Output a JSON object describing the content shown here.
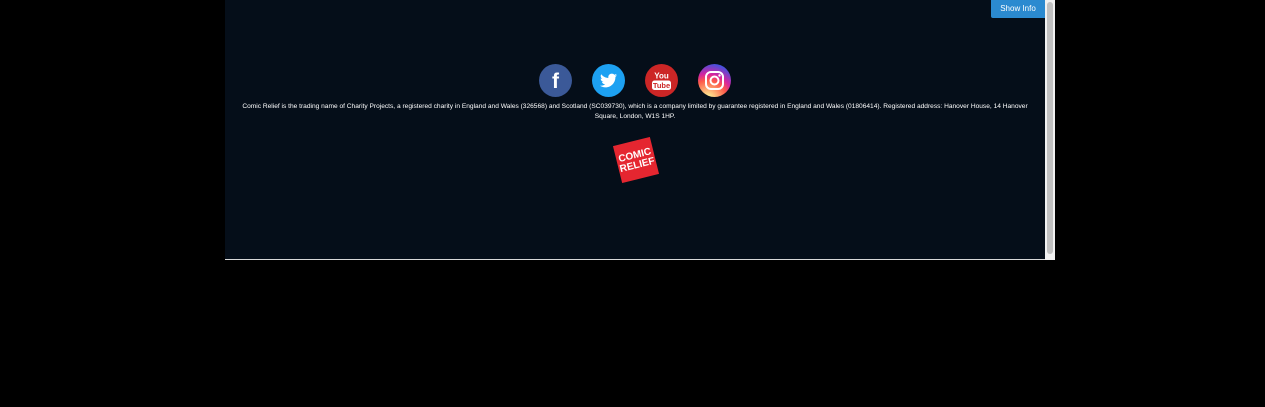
{
  "show_info_button": {
    "label": "Show Info"
  },
  "social": {
    "facebook": {
      "label": "f"
    },
    "youtube": {
      "top": "You",
      "bottom": "Tube"
    }
  },
  "footer": {
    "legal_text": "Comic Relief is the trading name of Charity Projects, a registered charity in England and Wales (326568) and Scotland (SC039730), which is a company limited by guarantee registered in England and Wales (01806414). Registered address: Hanover House, 14 Hanover Square, London, W1S 1HP."
  },
  "logo": {
    "line1": "COMIC",
    "line2": "RELIEF"
  },
  "colors": {
    "background": "#050e19",
    "accent": "#2b8ad0",
    "logo_red": "#e52630"
  }
}
